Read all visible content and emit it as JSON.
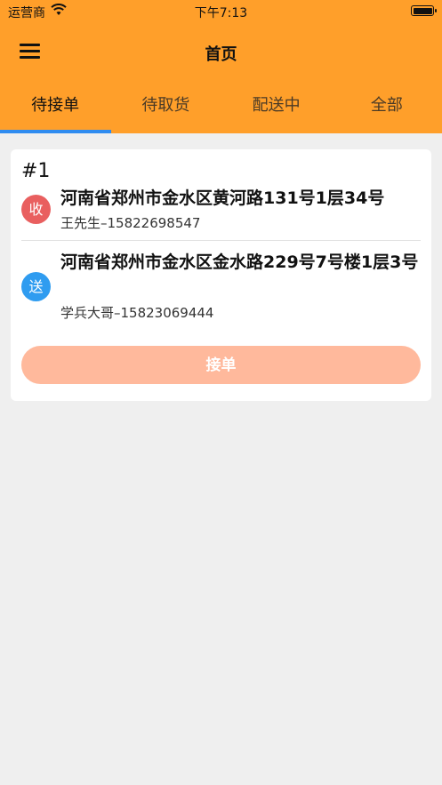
{
  "status_bar": {
    "carrier": "运营商",
    "time": "下午7:13"
  },
  "header": {
    "title": "首页"
  },
  "tabs": [
    {
      "label": "待接单",
      "active": true
    },
    {
      "label": "待取货",
      "active": false
    },
    {
      "label": "配送中",
      "active": false
    },
    {
      "label": "全部",
      "active": false
    }
  ],
  "order": {
    "number": "#1",
    "pickup": {
      "badge": "收",
      "address": "河南省郑州市金水区黄河路131号1层34号",
      "contact": "王先生–15822698547"
    },
    "delivery": {
      "badge": "送",
      "address": "河南省郑州市金水区金水路229号7号楼1层3号",
      "contact": "学兵大哥–15823069444"
    },
    "accept_label": "接单"
  },
  "colors": {
    "header_bg": "#ff9f2a",
    "tab_indicator": "#2f8cf0",
    "pickup_badge": "#e95f5f",
    "delivery_badge": "#2f9cf0",
    "accept_button": "#ffb99c"
  }
}
